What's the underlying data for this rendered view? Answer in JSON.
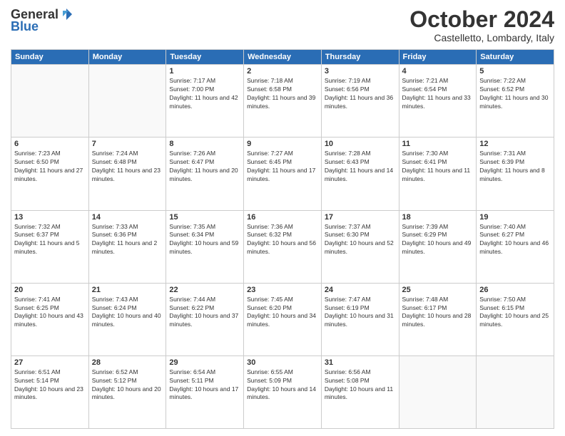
{
  "header": {
    "logo_general": "General",
    "logo_blue": "Blue",
    "month_title": "October 2024",
    "location": "Castelletto, Lombardy, Italy"
  },
  "weekdays": [
    "Sunday",
    "Monday",
    "Tuesday",
    "Wednesday",
    "Thursday",
    "Friday",
    "Saturday"
  ],
  "weeks": [
    [
      {
        "day": "",
        "info": ""
      },
      {
        "day": "",
        "info": ""
      },
      {
        "day": "1",
        "info": "Sunrise: 7:17 AM\nSunset: 7:00 PM\nDaylight: 11 hours and 42 minutes."
      },
      {
        "day": "2",
        "info": "Sunrise: 7:18 AM\nSunset: 6:58 PM\nDaylight: 11 hours and 39 minutes."
      },
      {
        "day": "3",
        "info": "Sunrise: 7:19 AM\nSunset: 6:56 PM\nDaylight: 11 hours and 36 minutes."
      },
      {
        "day": "4",
        "info": "Sunrise: 7:21 AM\nSunset: 6:54 PM\nDaylight: 11 hours and 33 minutes."
      },
      {
        "day": "5",
        "info": "Sunrise: 7:22 AM\nSunset: 6:52 PM\nDaylight: 11 hours and 30 minutes."
      }
    ],
    [
      {
        "day": "6",
        "info": "Sunrise: 7:23 AM\nSunset: 6:50 PM\nDaylight: 11 hours and 27 minutes."
      },
      {
        "day": "7",
        "info": "Sunrise: 7:24 AM\nSunset: 6:48 PM\nDaylight: 11 hours and 23 minutes."
      },
      {
        "day": "8",
        "info": "Sunrise: 7:26 AM\nSunset: 6:47 PM\nDaylight: 11 hours and 20 minutes."
      },
      {
        "day": "9",
        "info": "Sunrise: 7:27 AM\nSunset: 6:45 PM\nDaylight: 11 hours and 17 minutes."
      },
      {
        "day": "10",
        "info": "Sunrise: 7:28 AM\nSunset: 6:43 PM\nDaylight: 11 hours and 14 minutes."
      },
      {
        "day": "11",
        "info": "Sunrise: 7:30 AM\nSunset: 6:41 PM\nDaylight: 11 hours and 11 minutes."
      },
      {
        "day": "12",
        "info": "Sunrise: 7:31 AM\nSunset: 6:39 PM\nDaylight: 11 hours and 8 minutes."
      }
    ],
    [
      {
        "day": "13",
        "info": "Sunrise: 7:32 AM\nSunset: 6:37 PM\nDaylight: 11 hours and 5 minutes."
      },
      {
        "day": "14",
        "info": "Sunrise: 7:33 AM\nSunset: 6:36 PM\nDaylight: 11 hours and 2 minutes."
      },
      {
        "day": "15",
        "info": "Sunrise: 7:35 AM\nSunset: 6:34 PM\nDaylight: 10 hours and 59 minutes."
      },
      {
        "day": "16",
        "info": "Sunrise: 7:36 AM\nSunset: 6:32 PM\nDaylight: 10 hours and 56 minutes."
      },
      {
        "day": "17",
        "info": "Sunrise: 7:37 AM\nSunset: 6:30 PM\nDaylight: 10 hours and 52 minutes."
      },
      {
        "day": "18",
        "info": "Sunrise: 7:39 AM\nSunset: 6:29 PM\nDaylight: 10 hours and 49 minutes."
      },
      {
        "day": "19",
        "info": "Sunrise: 7:40 AM\nSunset: 6:27 PM\nDaylight: 10 hours and 46 minutes."
      }
    ],
    [
      {
        "day": "20",
        "info": "Sunrise: 7:41 AM\nSunset: 6:25 PM\nDaylight: 10 hours and 43 minutes."
      },
      {
        "day": "21",
        "info": "Sunrise: 7:43 AM\nSunset: 6:24 PM\nDaylight: 10 hours and 40 minutes."
      },
      {
        "day": "22",
        "info": "Sunrise: 7:44 AM\nSunset: 6:22 PM\nDaylight: 10 hours and 37 minutes."
      },
      {
        "day": "23",
        "info": "Sunrise: 7:45 AM\nSunset: 6:20 PM\nDaylight: 10 hours and 34 minutes."
      },
      {
        "day": "24",
        "info": "Sunrise: 7:47 AM\nSunset: 6:19 PM\nDaylight: 10 hours and 31 minutes."
      },
      {
        "day": "25",
        "info": "Sunrise: 7:48 AM\nSunset: 6:17 PM\nDaylight: 10 hours and 28 minutes."
      },
      {
        "day": "26",
        "info": "Sunrise: 7:50 AM\nSunset: 6:15 PM\nDaylight: 10 hours and 25 minutes."
      }
    ],
    [
      {
        "day": "27",
        "info": "Sunrise: 6:51 AM\nSunset: 5:14 PM\nDaylight: 10 hours and 23 minutes."
      },
      {
        "day": "28",
        "info": "Sunrise: 6:52 AM\nSunset: 5:12 PM\nDaylight: 10 hours and 20 minutes."
      },
      {
        "day": "29",
        "info": "Sunrise: 6:54 AM\nSunset: 5:11 PM\nDaylight: 10 hours and 17 minutes."
      },
      {
        "day": "30",
        "info": "Sunrise: 6:55 AM\nSunset: 5:09 PM\nDaylight: 10 hours and 14 minutes."
      },
      {
        "day": "31",
        "info": "Sunrise: 6:56 AM\nSunset: 5:08 PM\nDaylight: 10 hours and 11 minutes."
      },
      {
        "day": "",
        "info": ""
      },
      {
        "day": "",
        "info": ""
      }
    ]
  ]
}
